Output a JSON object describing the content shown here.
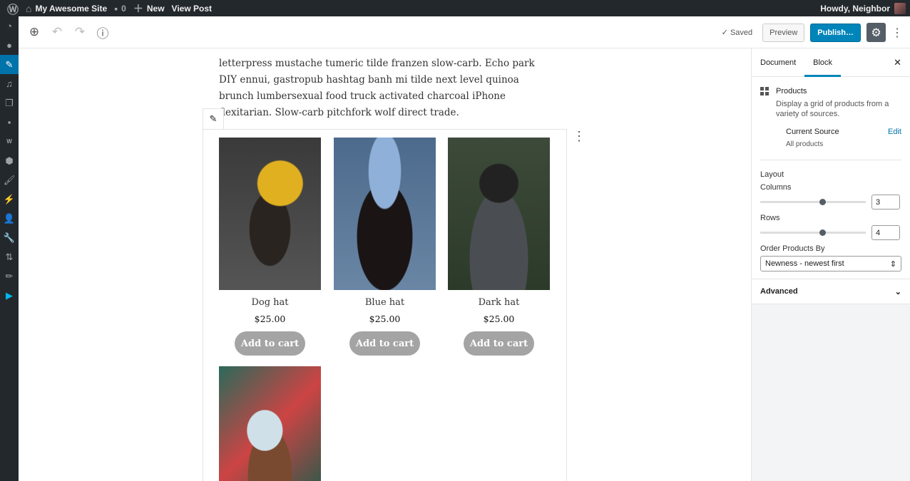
{
  "adminbar": {
    "site": "My Awesome Site",
    "comments": "0",
    "new": "New",
    "view": "View Post",
    "howdy": "Howdy, Neighbor"
  },
  "toolbar": {
    "saved": "Saved",
    "preview": "Preview",
    "publish": "Publish…"
  },
  "content": {
    "paragraph": "letterpress mustache tumeric tilde franzen slow-carb. Echo park DIY ennui, gastropub hashtag banh mi tilde next level quinoa brunch lumbersexual food truck activated charcoal iPhone flexitarian. Slow-carb pitchfork wolf direct trade."
  },
  "products": [
    {
      "name": "Dog hat",
      "price": "$25.00",
      "button": "Add to cart"
    },
    {
      "name": "Blue hat",
      "price": "$25.00",
      "button": "Add to cart"
    },
    {
      "name": "Dark hat",
      "price": "$25.00",
      "button": "Add to cart"
    },
    {
      "name": "",
      "price": "",
      "button": ""
    }
  ],
  "sidebar": {
    "tabs": [
      "Document",
      "Block"
    ],
    "block_title": "Products",
    "block_desc": "Display a grid of products from a variety of sources.",
    "source_label": "Current Source",
    "source_edit": "Edit",
    "source_value": "All products",
    "layout": "Layout",
    "columns_label": "Columns",
    "columns": "3",
    "rows_label": "Rows",
    "rows": "4",
    "order_label": "Order Products By",
    "order_value": "Newness - newest first",
    "advanced": "Advanced"
  },
  "colors": {
    "accent": "#0085ba",
    "adminbar": "#23282d",
    "cart_button": "#a4a4a4"
  }
}
